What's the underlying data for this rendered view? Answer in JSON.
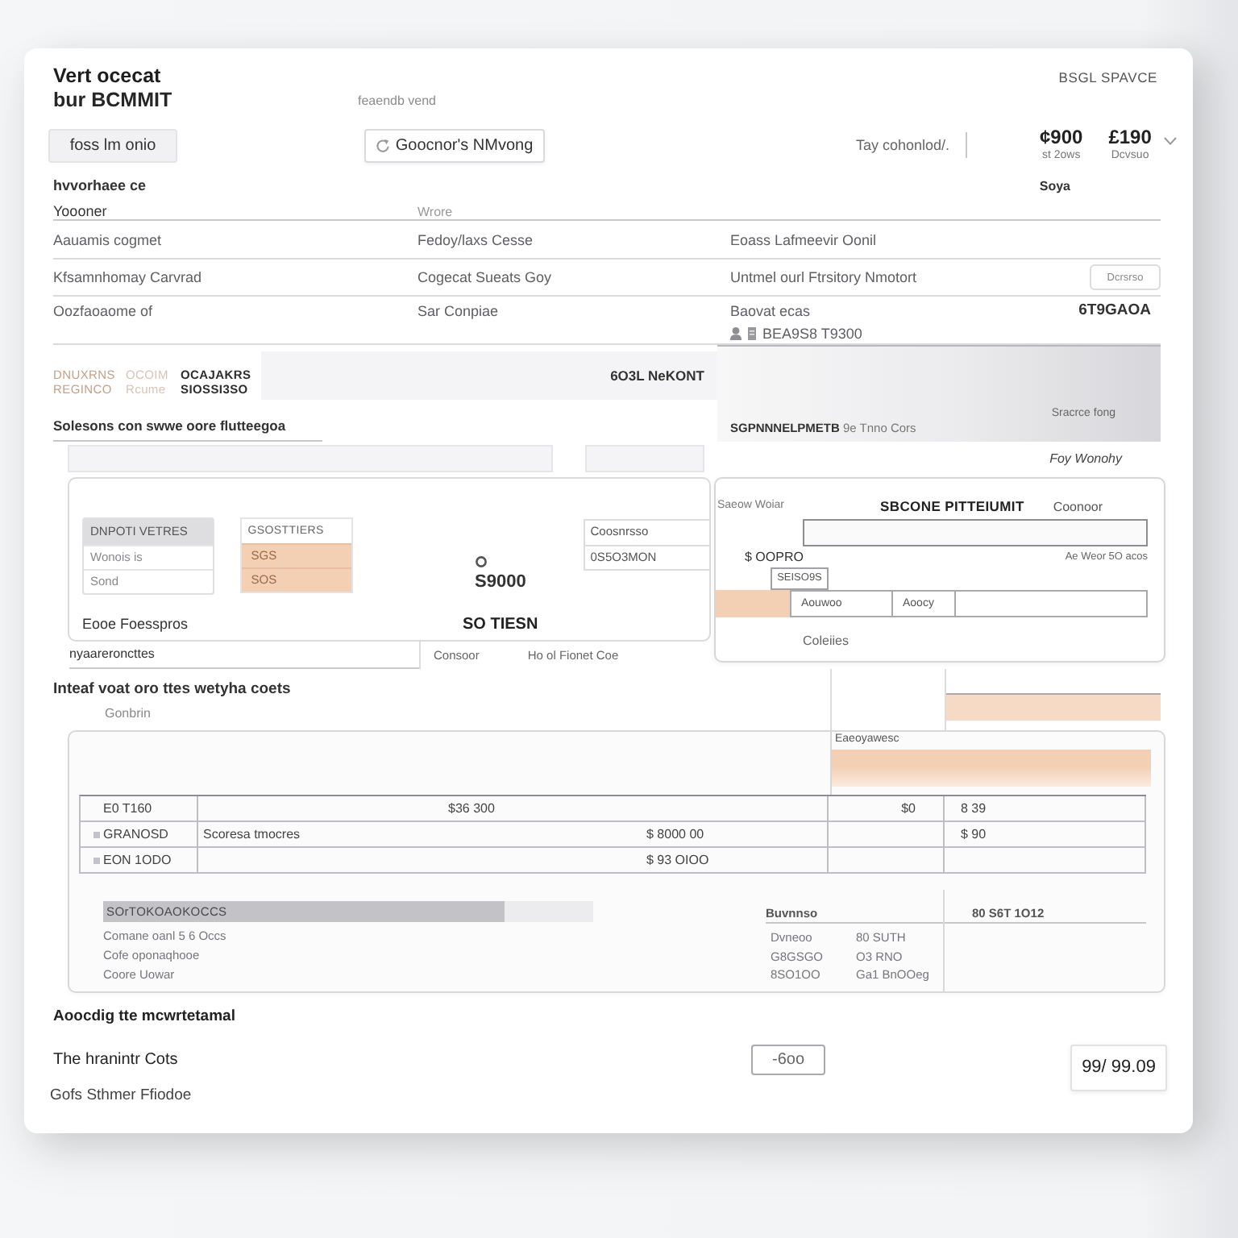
{
  "header": {
    "title": "Vert ocecat",
    "subtitle": "bur BCMMIT",
    "caption": "feaendb vend",
    "corner_label": "BSGL SPAVCE"
  },
  "toolbar": {
    "buttons": [
      {
        "kind": "plain",
        "label": "foss lm onio"
      },
      {
        "kind": "icon",
        "label": "Goocnor's NMvong"
      }
    ],
    "field": {
      "value": "Tay cohonlod/."
    },
    "stats": [
      {
        "value": "¢900",
        "caption": "st 2ows"
      },
      {
        "value": "£190",
        "caption": "Dcvsuo"
      }
    ]
  },
  "section": {
    "label": "hvvorhaee ce",
    "note": "Soya"
  },
  "table": {
    "columns": [
      "Yoooner",
      "Wrore"
    ],
    "rows": [
      {
        "cells": [
          "Aauamis cogmet",
          "Fedoy/laxs Cesse",
          "Eoass Lafmeevir Oonil"
        ]
      },
      {
        "cells": [
          "Kfsamnhomay Carvrad",
          "Cogecat Sueats Goy",
          "Untmel ourl Ftrsitory Nmotort"
        ],
        "button": "Dcrsrso"
      },
      {
        "cells": [
          "Oozfaoaome of",
          "Sar Conpiae",
          "Baovat ecas"
        ],
        "total": "6T9GAOA",
        "reference": "BEA9S8 T9300"
      }
    ]
  },
  "summary": {
    "codes": [
      [
        "DNUXRNS",
        "OCOIM",
        "OCAJAKRS"
      ],
      [
        "REGINCO",
        "Rcume",
        "SIOSSI3SO"
      ]
    ],
    "bar_label": "6O3L NeKONT",
    "filter_label": "Solesons con swwe oore flutteegoa",
    "panel_caption": "Sracrce fong",
    "panel_title": "**SGPNNNELPMETB** 9e Tnno Cors"
  },
  "filters": {
    "fields": [
      {
        "kind": "wide"
      },
      {
        "kind": "narrow"
      }
    ],
    "note": "Foy Wonohy"
  },
  "breakdown": {
    "list": {
      "header": "DNPOTI VETRES",
      "items": [
        "Wonois is",
        "Sond"
      ]
    },
    "tiers": {
      "header": "GSOSTTIERS",
      "items": [
        "SGS",
        "SOS"
      ]
    },
    "amount": "S9000",
    "side_items": [
      "Coosnrsso",
      "0S5O3MON"
    ],
    "footer_label": "Eooe Foesspros",
    "footer_value": "SO TIESN",
    "row": {
      "label": "nyaareroncttes",
      "column_2": "Consoor",
      "column_3": "Ho ol Fionet Coe"
    }
  },
  "payment": {
    "caption": "Saeow Woiar",
    "title": "SBCONE PITTEIUMIT",
    "side_label": "Coonoor",
    "amount": "$ OOPRO",
    "note": "Ae Weor 5O acos",
    "code": "SEISO9S",
    "cells": [
      "Aouwoo",
      "Aoocy"
    ],
    "footer": "Coleiies"
  },
  "weights": {
    "title": "Inteaf voat oro ttes wetyha coets",
    "subtitle": "Gonbrin"
  },
  "costs": {
    "caption": "Eaeoyawesc",
    "rows": [
      {
        "kind": "total",
        "code": "E0 T160",
        "amount": "$36 300",
        "column_3": "$0",
        "column_4": "8 39"
      },
      {
        "kind": "line",
        "code": "GRANOSD",
        "label": "Scoresa tmocres",
        "amount": "$ 8000 00",
        "column_4": "$ 90"
      },
      {
        "kind": "line",
        "code": "EON 1ODO",
        "amount": "$ 93 OIOO"
      }
    ],
    "progress": {
      "label": "SOrTOKOAOKOCCS",
      "level": 0.82
    },
    "lines": [
      "Comane oanl 5 6 Occs",
      "Cofe oponaqhooe",
      "Coore Uowar"
    ],
    "summary": {
      "header": "Buvnnso",
      "side_header": "80 S6T 1O12",
      "rows": [
        [
          "Dvneoo",
          "80 SUTH"
        ],
        [
          "G8GSGO",
          "O3 RNO"
        ],
        [
          "8SO1OO",
          "Ga1 BnOOeg"
        ]
      ]
    }
  },
  "footer": {
    "heading": "Aoocdig tte mcwrtetamal",
    "total_label": "The hranintr Cots",
    "badge": "-6oo",
    "total": "99/ 99.09",
    "note": "Gofs Sthmer Ffiodoe"
  }
}
